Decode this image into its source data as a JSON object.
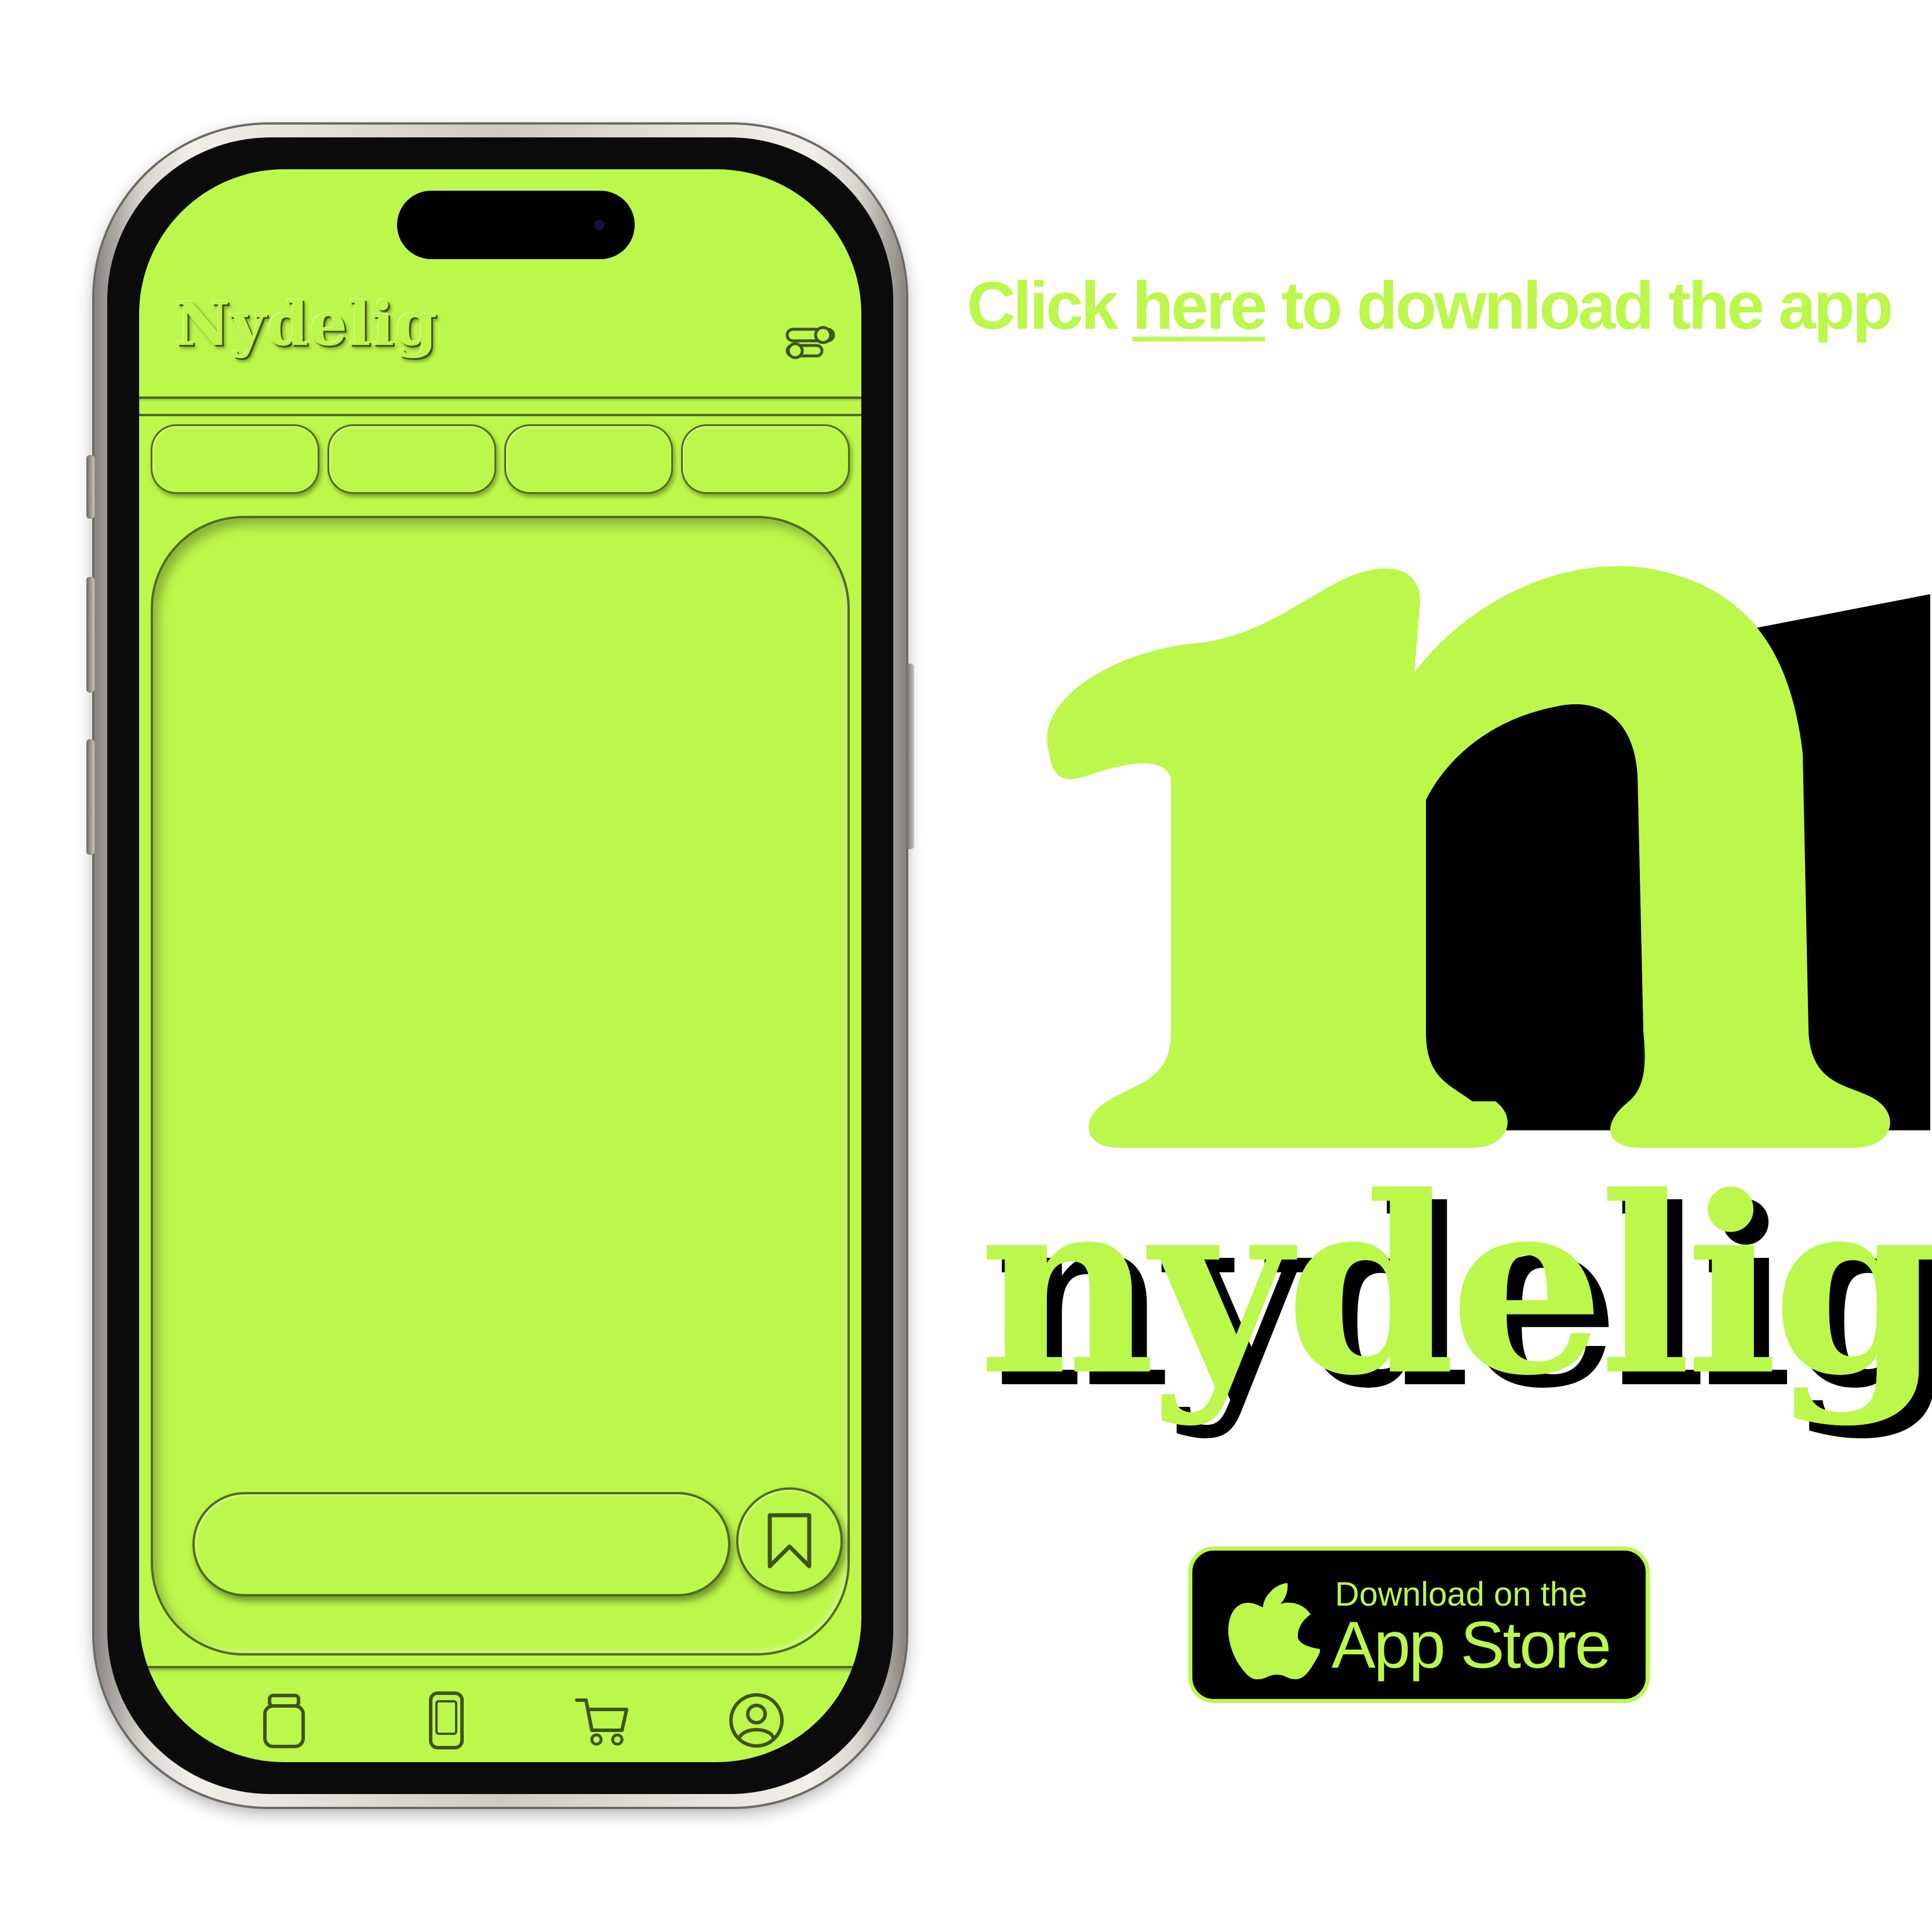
{
  "phone": {
    "app_title": "Nydelig",
    "tabs": [
      "",
      "",
      "",
      ""
    ],
    "search_placeholder": "",
    "nav_items": [
      {
        "icon": "jar-icon"
      },
      {
        "icon": "phone-icon"
      },
      {
        "icon": "cart-icon"
      },
      {
        "icon": "profile-icon"
      }
    ]
  },
  "promo": {
    "download_prefix": "Click ",
    "download_link": "here",
    "download_suffix": " to download the app",
    "logo_letter": "n",
    "logo_wordmark": "nydelig"
  },
  "badge": {
    "small_text": "Download on the",
    "large_text": "App Store"
  },
  "colors": {
    "accent": "#bcf74b",
    "dark": "#000000",
    "outline": "#4f6b1d"
  }
}
